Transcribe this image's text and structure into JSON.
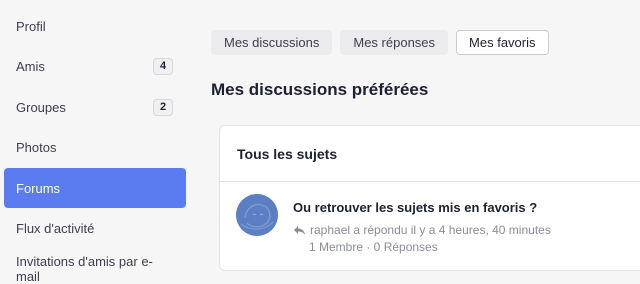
{
  "sidebar": {
    "items": [
      {
        "label": "Profil"
      },
      {
        "label": "Amis",
        "count": "4"
      },
      {
        "label": "Groupes",
        "count": "2"
      },
      {
        "label": "Photos"
      },
      {
        "label": "Forums",
        "active": true
      },
      {
        "label": "Flux d'activité"
      },
      {
        "label": "Invitations d'amis par e-mail"
      }
    ]
  },
  "tabs": [
    {
      "label": "Mes discussions"
    },
    {
      "label": "Mes réponses"
    },
    {
      "label": "Mes favoris",
      "active": true
    }
  ],
  "main": {
    "title": "Mes discussions préférées",
    "card_title": "Tous les sujets",
    "topic": {
      "title": "Ou retrouver les sujets mis en favoris ?",
      "meta": "raphael a répondu il y a 4 heures, 40 minutes",
      "stats": "1 Membre · 0 Réponses"
    }
  },
  "colors": {
    "accent": "#5a7cf0",
    "avatar": "#5b7fc2"
  },
  "icons": {
    "reply": "reply-arrow-icon",
    "avatar": "user-avatar"
  }
}
